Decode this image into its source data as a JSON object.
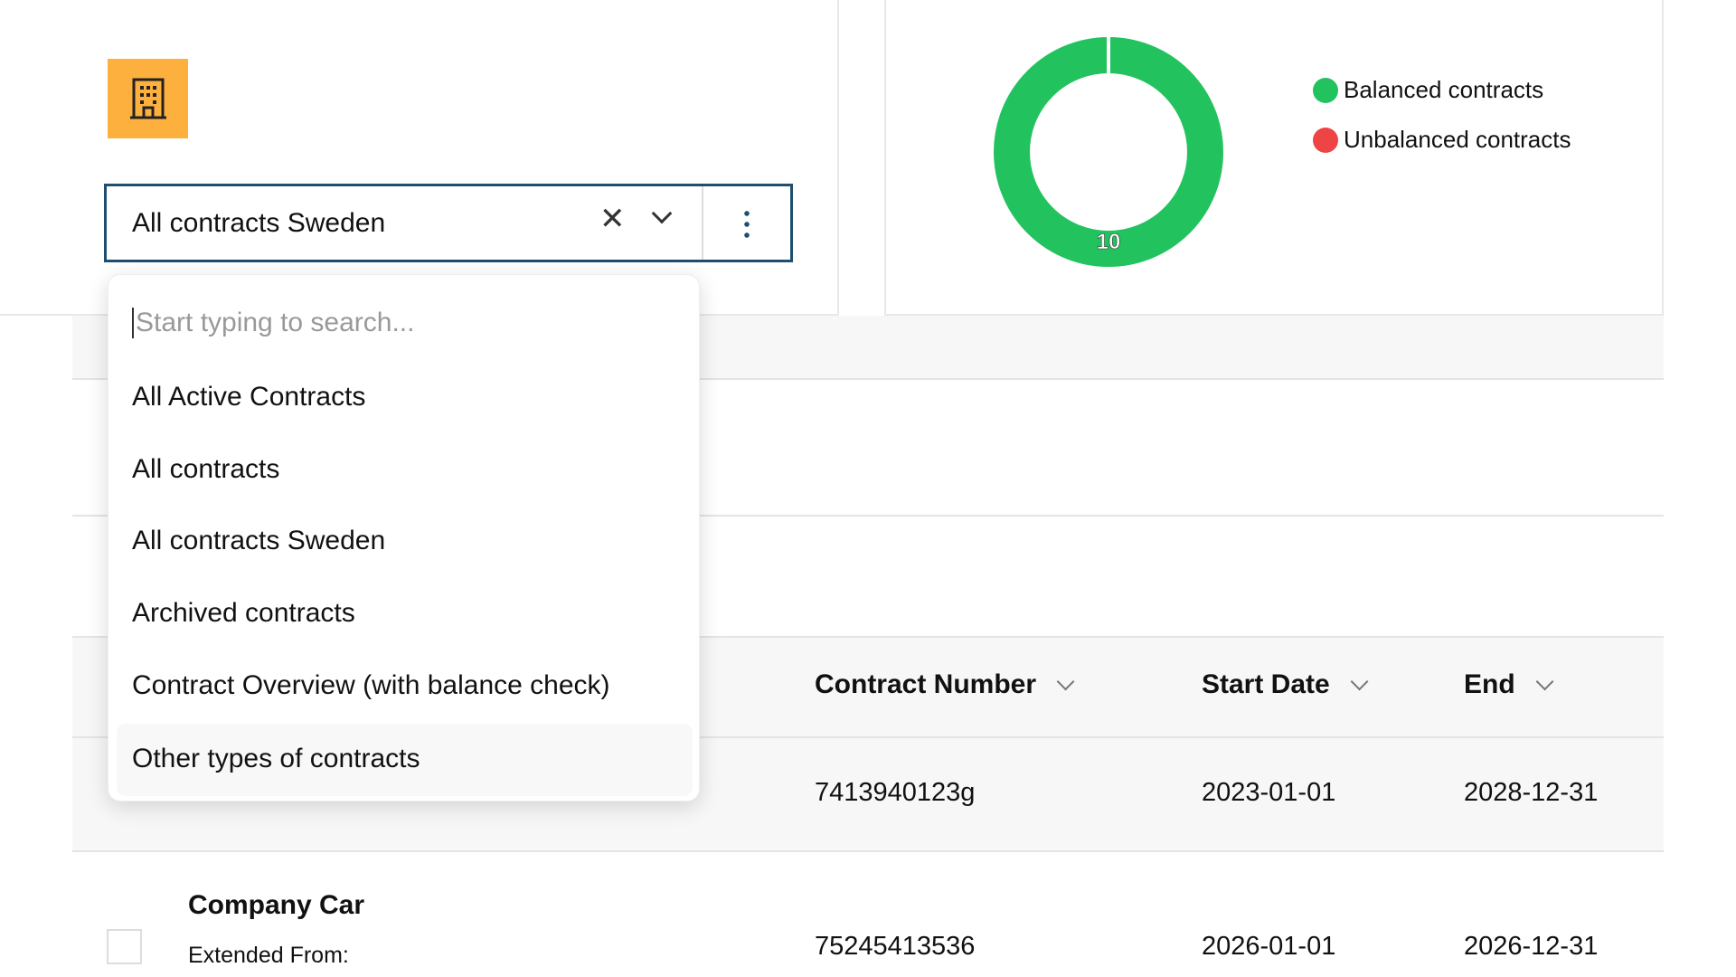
{
  "colors": {
    "accent": "#1f4e6e",
    "icon_bg": "#fdb03d",
    "balanced": "#22c35e",
    "unbalanced": "#ef4444"
  },
  "icon": "building-icon",
  "selector": {
    "value": "All contracts Sweden"
  },
  "dropdown": {
    "placeholder": "Start typing to search...",
    "options": [
      "All Active Contracts",
      "All contracts",
      "All contracts Sweden",
      "Archived contracts",
      "Contract Overview (with balance check)",
      "Other types of contracts"
    ],
    "hovered": "Other types of contracts"
  },
  "chart_data": {
    "type": "pie",
    "categories": [
      "Balanced contracts",
      "Unbalanced contracts"
    ],
    "values": [
      10,
      0
    ],
    "data_labels": [
      "10"
    ],
    "legend": "right"
  },
  "table": {
    "headers": [
      "Contract Number",
      "Start Date",
      "End"
    ],
    "rows": [
      {
        "contract_number": "7413940123g",
        "start": "2023-01-01",
        "end": "2028-12-31"
      },
      {
        "name": "Company Car",
        "sub": "Extended From:",
        "contract_number": "75245413536",
        "start": "2026-01-01",
        "end": "2026-12-31"
      }
    ]
  }
}
